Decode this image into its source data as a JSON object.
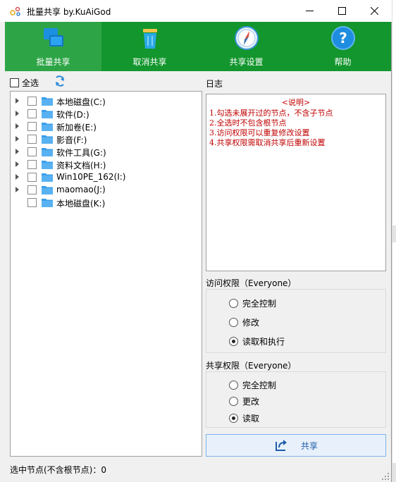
{
  "window": {
    "title": "批量共享 by.KuAiGod"
  },
  "toolbar": {
    "items": [
      {
        "label": "批量共享",
        "icon": "windows-share-icon",
        "active": true
      },
      {
        "label": "取消共享",
        "icon": "trash-bin-icon",
        "active": false
      },
      {
        "label": "共享设置",
        "icon": "compass-icon",
        "active": false
      },
      {
        "label": "帮助",
        "icon": "help-icon",
        "active": false
      }
    ]
  },
  "left": {
    "select_all_label": "全选",
    "tree": [
      {
        "label": "本地磁盘(C:)",
        "expandable": true
      },
      {
        "label": "软件(D:)",
        "expandable": true
      },
      {
        "label": "新加卷(E:)",
        "expandable": true
      },
      {
        "label": "影音(F:)",
        "expandable": true
      },
      {
        "label": "软件工具(G:)",
        "expandable": true
      },
      {
        "label": "资料文档(H:)",
        "expandable": true
      },
      {
        "label": "Win10PE_162(I:)",
        "expandable": true
      },
      {
        "label": "maomao(J:)",
        "expandable": true
      },
      {
        "label": "本地磁盘(K:)",
        "expandable": false
      }
    ],
    "status": "选中节点(不含根节点)：0"
  },
  "log": {
    "label": "日志",
    "title": "<说明>",
    "lines": [
      "1.勾选未展开过的节点，不含子节点",
      "2.全选时不包含根节点",
      "3.访问权限可以重复修改设置",
      "4.共享权限需取消共享后重新设置"
    ]
  },
  "access": {
    "label": "访问权限（Everyone）",
    "options": [
      "完全控制",
      "修改",
      "读取和执行"
    ],
    "selected": 2
  },
  "share_perm": {
    "label": "共享权限（Everyone）",
    "options": [
      "完全控制",
      "更改",
      "读取"
    ],
    "selected": 2
  },
  "share_button": {
    "label": "共享"
  },
  "colors": {
    "toolbar": "#12962d",
    "toolbar_active": "#2da546",
    "log_text": "#c00000",
    "accent": "#1e5ba8"
  }
}
